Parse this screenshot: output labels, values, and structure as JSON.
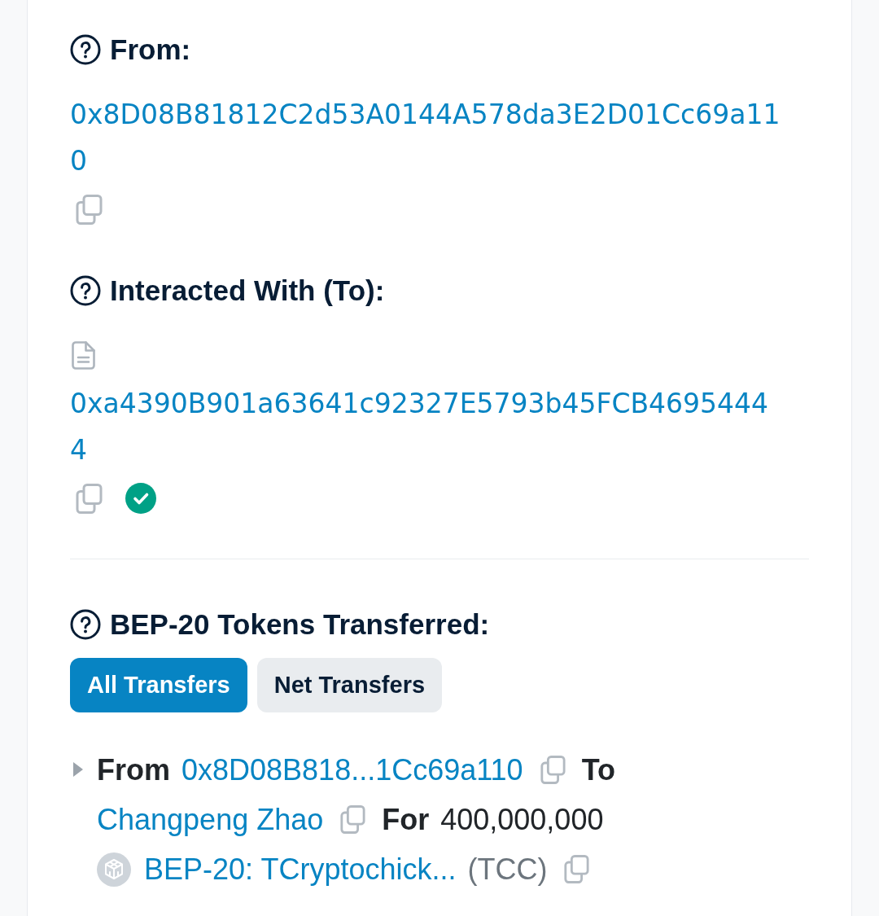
{
  "sections": [
    {
      "label": "From:",
      "address": "0x8D08B81812C2d53A0144A578da3E2D01Cc69a110"
    },
    {
      "label": "Interacted With (To):",
      "contract": true,
      "address": "0xa4390B901a63641c92327E5793b45FCB46954444",
      "verified": true
    }
  ],
  "tokens_transferred": {
    "label": "BEP-20 Tokens Transferred:",
    "tabs": [
      {
        "label": "All Transfers",
        "selected": true
      },
      {
        "label": "Net Transfers",
        "selected": false
      }
    ],
    "transfers": [
      {
        "expanded": false,
        "from_label": "From",
        "from": "0x8D08B818...1Cc69a110",
        "to_label": "To",
        "to": "Changpeng Zhao",
        "for_label": "For",
        "amount": "400,000,000",
        "token": "BEP-20: TCryptochick...",
        "symbol": "(TCC)"
      }
    ]
  }
}
